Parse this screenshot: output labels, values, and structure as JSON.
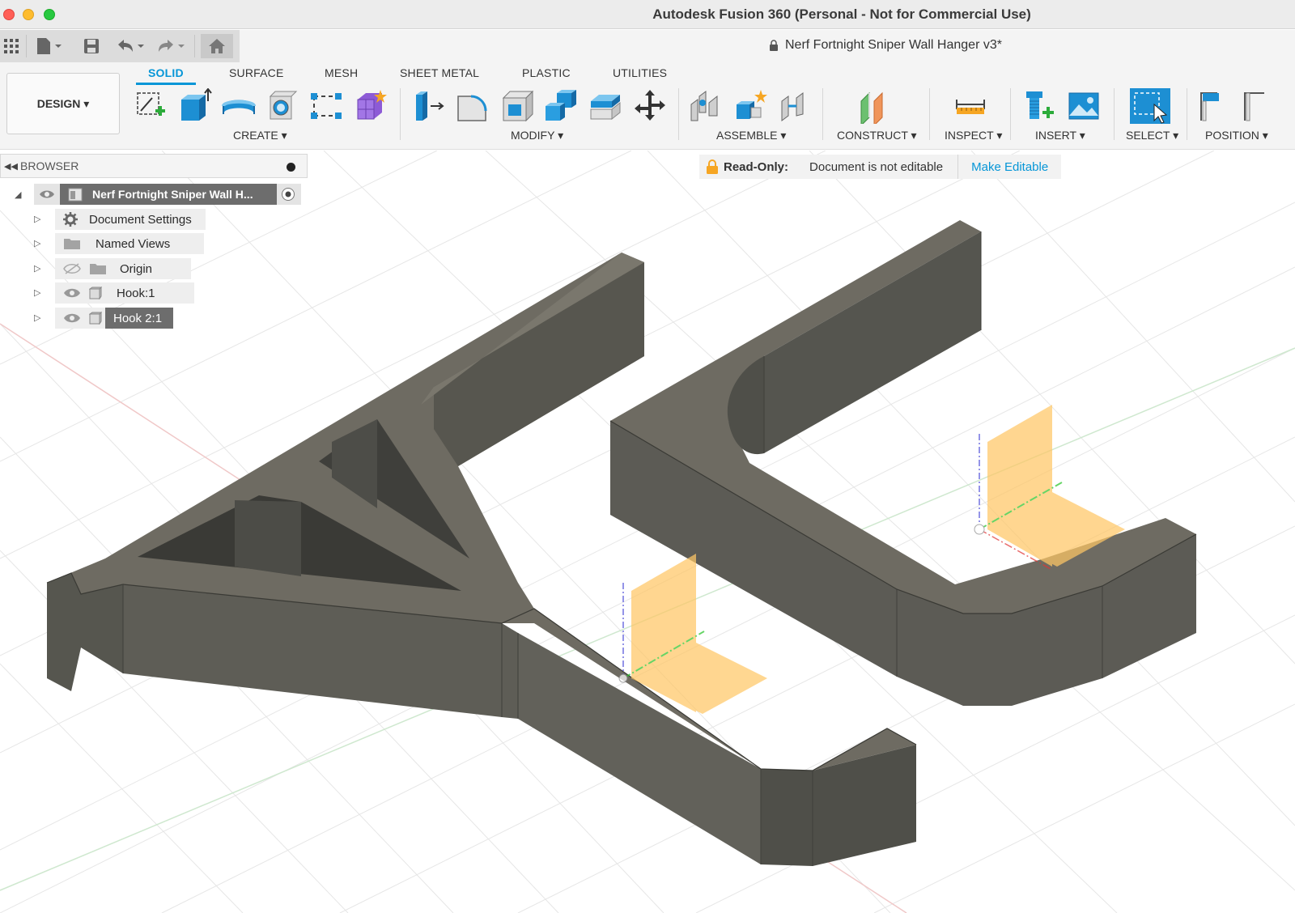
{
  "window": {
    "title": "Autodesk Fusion 360 (Personal - Not for Commercial Use)"
  },
  "document": {
    "title": "Nerf Fortnight Sniper Wall Hanger v3*"
  },
  "quick_access": {
    "icons": [
      "grid-icon",
      "file-icon",
      "save-icon",
      "undo-icon",
      "redo-icon",
      "home-icon"
    ]
  },
  "toolbar": {
    "workspace": "DESIGN ▾",
    "tabs": [
      {
        "label": "SOLID",
        "active": true
      },
      {
        "label": "SURFACE",
        "active": false
      },
      {
        "label": "MESH",
        "active": false
      },
      {
        "label": "SHEET METAL",
        "active": false
      },
      {
        "label": "PLASTIC",
        "active": false
      },
      {
        "label": "UTILITIES",
        "active": false
      }
    ],
    "groups": [
      {
        "label": "CREATE ▾",
        "tools": [
          "create-sketch-icon",
          "extrude-icon",
          "revolve-icon",
          "hole-icon",
          "pattern-icon",
          "create-form-icon"
        ]
      },
      {
        "label": "MODIFY ▾",
        "tools": [
          "press-pull-icon",
          "fillet-icon",
          "shell-icon",
          "combine-icon",
          "offset-face-icon",
          "move-icon"
        ]
      },
      {
        "label": "ASSEMBLE ▾",
        "tools": [
          "joint-icon",
          "new-component-icon",
          "as-built-joint-icon"
        ]
      },
      {
        "label": "CONSTRUCT ▾",
        "tools": [
          "offset-plane-icon"
        ]
      },
      {
        "label": "INSPECT ▾",
        "tools": [
          "measure-icon"
        ]
      },
      {
        "label": "INSERT ▾",
        "tools": [
          "insert-mcmaster-icon",
          "insert-image-icon"
        ]
      },
      {
        "label": "SELECT ▾",
        "tools": [
          "select-icon"
        ]
      },
      {
        "label": "POSITION ▾",
        "tools": [
          "position-icon"
        ]
      }
    ]
  },
  "readonly_banner": {
    "title": "Read-Only:",
    "message": "Document is not editable",
    "action": "Make Editable"
  },
  "browser": {
    "header": "BROWSER",
    "root": {
      "label": "Nerf Fortnight Sniper Wall H..."
    },
    "items": [
      {
        "label": "Document Settings",
        "icon": "gear-icon"
      },
      {
        "label": "Named Views",
        "icon": "folder-icon"
      },
      {
        "label": "Origin",
        "icon": "folder-icon",
        "visible": false
      },
      {
        "label": "Hook:1",
        "icon": "component-icon",
        "visible": true
      },
      {
        "label": "Hook 2:1",
        "icon": "component-icon",
        "visible": true,
        "selected": true
      }
    ]
  },
  "colors": {
    "accent": "#0696d7",
    "model_top": "#6e6b62",
    "model_side": "#55554f",
    "origin_plane": "#ffc766"
  }
}
